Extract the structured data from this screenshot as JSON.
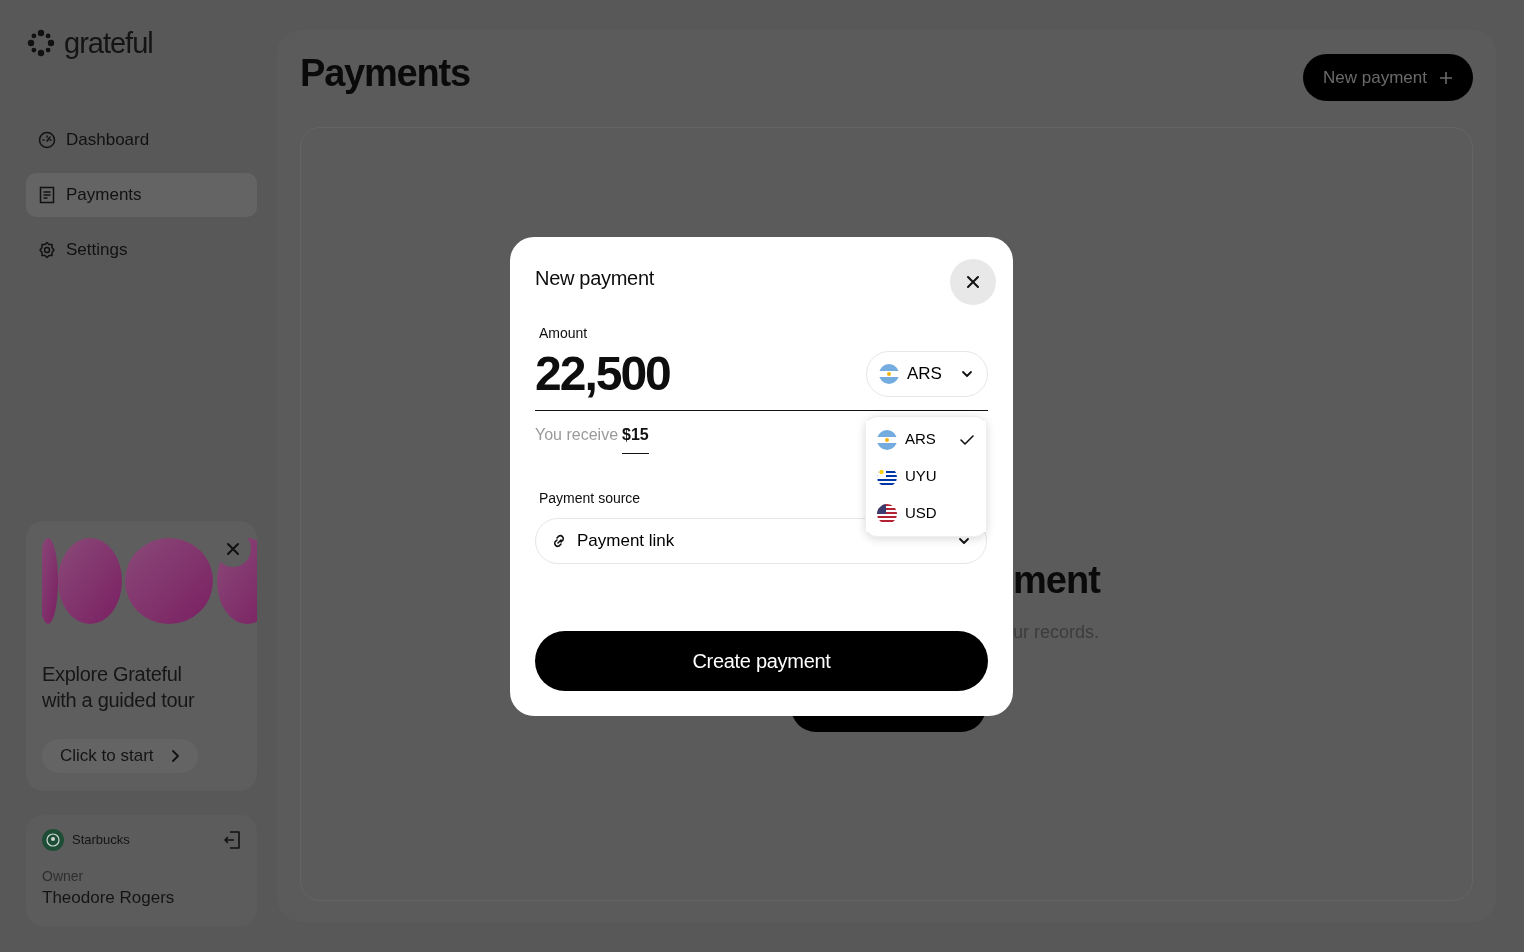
{
  "sidebar": {
    "logo": "grateful",
    "nav": [
      {
        "label": "Dashboard",
        "selected": false
      },
      {
        "label": "Payments",
        "selected": true
      },
      {
        "label": "Settings",
        "selected": false
      }
    ],
    "promo": {
      "title": "Explore Grateful with a guided tour",
      "button": "Click to start"
    },
    "account": {
      "business": "Starbucks",
      "role": "Owner",
      "name": "Theodore Rogers"
    }
  },
  "main": {
    "title": "Payments",
    "new_button": "New payment",
    "empty_state": {
      "title": "ment",
      "text": "ur records."
    }
  },
  "modal": {
    "title": "New payment",
    "amount_label": "Amount",
    "amount": "22,500",
    "currency": {
      "code": "ARS"
    },
    "receive_label": "You receive",
    "receive_value": "$15",
    "currencies": [
      {
        "code": "ARS",
        "selected": true
      },
      {
        "code": "UYU",
        "selected": false
      },
      {
        "code": "USD",
        "selected": false
      }
    ],
    "source_label": "Payment source",
    "source": "Payment link",
    "submit": "Create payment"
  }
}
